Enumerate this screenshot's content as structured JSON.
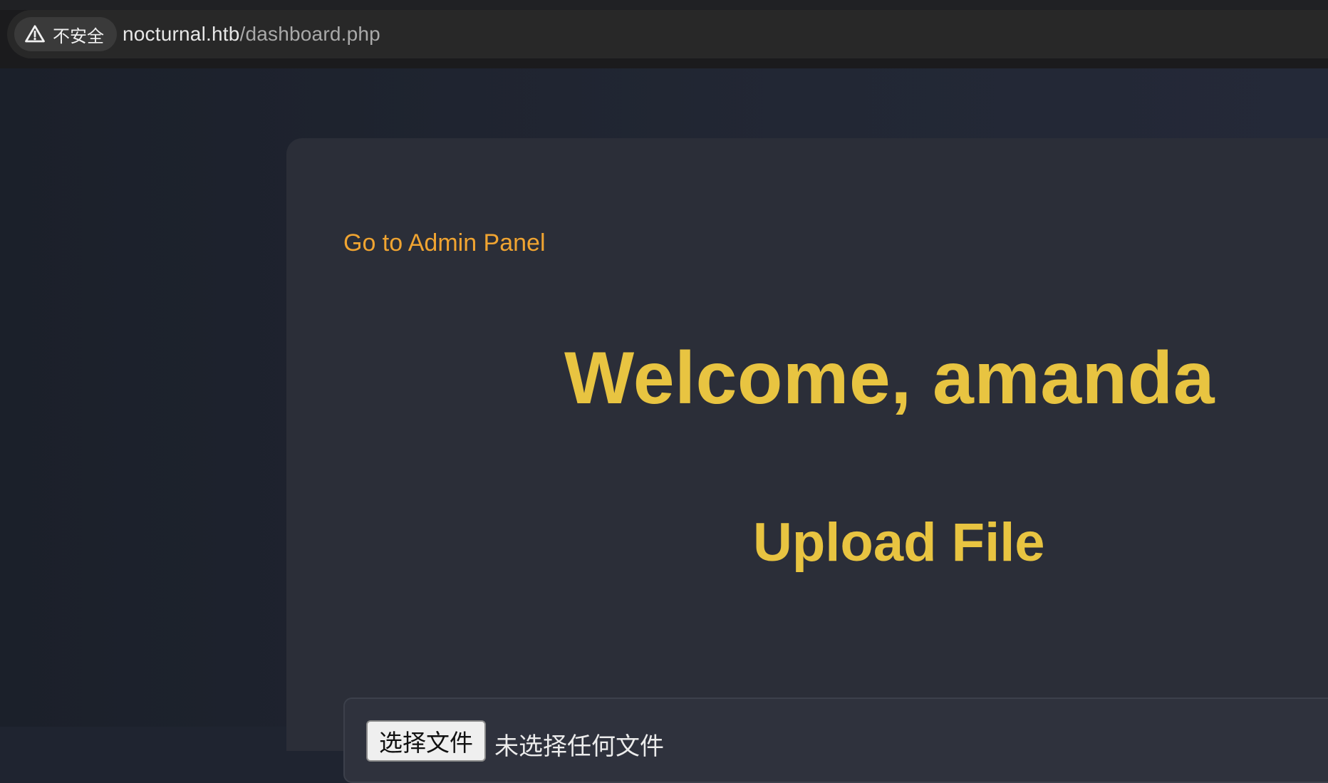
{
  "browser": {
    "security_label": "不安全",
    "url_host": "nocturnal.htb",
    "url_path": "/dashboard.php",
    "warning_icon": "warning-icon"
  },
  "page": {
    "admin_link": "Go to Admin Panel",
    "welcome_heading": "Welcome, amanda",
    "upload_heading": "Upload File",
    "file_input": {
      "button_label": "选择文件",
      "status_text": "未选择任何文件"
    }
  },
  "colors": {
    "accent_yellow": "#e8c441",
    "link_orange": "#f0a431",
    "card_bg": "#2b2e38",
    "page_bg": "#1f2430"
  }
}
